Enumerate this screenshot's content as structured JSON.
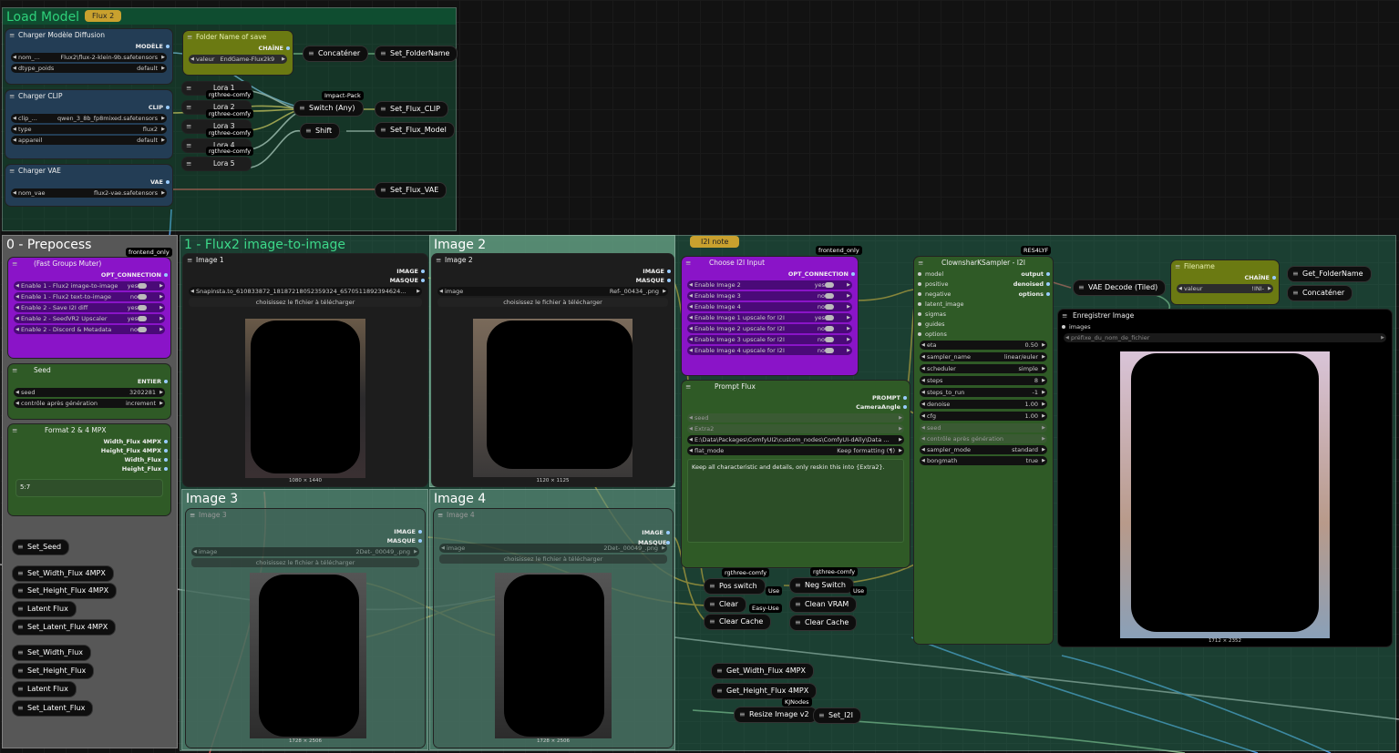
{
  "groups": {
    "load_model": "Load Model",
    "flux2_badge": "Flux 2",
    "prepocess": "0 - Prepocess",
    "flux2_i2i": "1 - Flux2 image-to-image",
    "image2": "Image 2",
    "image3": "Image 3",
    "image4": "Image 4",
    "i2i_note": "I2I note"
  },
  "tags": {
    "frontend_only": "frontend_only",
    "impact_pack": "Impact-Pack",
    "rgthree": "rgthree-comfy",
    "res4lyf": "RES4LYF",
    "kjnodes": "KJNodes",
    "use": "Use",
    "easy_use": "Easy-Use"
  },
  "diffusion": {
    "title": "Charger Modèle Diffusion",
    "out": "MODÈLE",
    "w1_label": "nom_...",
    "w1_val": "Flux2\\flux-2-klein-9b.safetensors",
    "w2_label": "dtype_poids",
    "w2_val": "default"
  },
  "clip": {
    "title": "Charger CLIP",
    "out": "CLIP",
    "w1_label": "clip_...",
    "w1_val": "qwen_3_8b_fp8mixed.safetensors",
    "w2_label": "type",
    "w2_val": "flux2",
    "w3_label": "appareil",
    "w3_val": "default"
  },
  "vae": {
    "title": "Charger VAE",
    "out": "VAE",
    "w1_label": "nom_vae",
    "w1_val": "flux2-vae.safetensors"
  },
  "folder": {
    "title": "Folder Name of save",
    "out": "CHAÎNE",
    "label": "valeur",
    "value": "EndGame-Flux2k9"
  },
  "loras": [
    "Lora 1",
    "Lora 2",
    "Lora 3",
    "Lora 4",
    "Lora 5"
  ],
  "pills": {
    "concat": "Concaténer",
    "set_folder": "Set_FolderName",
    "switch_any": "Switch (Any)",
    "set_clip": "Set_Flux_CLIP",
    "shift": "Shift",
    "set_model": "Set_Flux_Model",
    "set_vae": "Set_Flux_VAE"
  },
  "muter": {
    "title": "(Fast Groups Muter)",
    "out": "OPT_CONNECTION",
    "rows": [
      {
        "label": "Enable 1 - Flux2 image-to-image",
        "val": "yes"
      },
      {
        "label": "Enable 1 - Flux2 text-to-image",
        "val": "no"
      },
      {
        "label": "Enable 2 - Save I2I diff",
        "val": "yes"
      },
      {
        "label": "Enable 2 - SeedVR2 Upscaler",
        "val": "yes"
      },
      {
        "label": "Enable 2 - Discord & Metadata",
        "val": "no"
      }
    ]
  },
  "seed": {
    "title": "Seed",
    "out": "ENTIER",
    "w1_label": "seed",
    "w1_val": "3202281",
    "w2_label": "contrôle après génération",
    "w2_val": "increment"
  },
  "format": {
    "title": "Format  2 & 4 MPX",
    "outs": [
      "Width_Flux 4MPX",
      "Height_Flux 4MPX",
      "Width_Flux",
      "Height_Flux"
    ],
    "ratio": "5:7"
  },
  "set_pills": [
    "Set_Seed",
    "Set_Width_Flux 4MPX",
    "Set_Height_Flux 4MPX",
    "Latent Flux",
    "Set_Latent_Flux 4MPX",
    "Set_Width_Flux",
    "Set_Height_Flux",
    "Latent Flux",
    "Set_Latent_Flux"
  ],
  "image1": {
    "title": "Image 1",
    "out1": "IMAGE",
    "out2": "MASQUE",
    "file": "Snapinsta.to_610833872_18187218052359324_6570511892394624...",
    "upload": "choisissez le fichier à télécharger",
    "size": "1080 × 1440"
  },
  "image2n": {
    "title": "Image 2",
    "out1": "IMAGE",
    "out2": "MASQUE",
    "label": "image",
    "file": "Ref-_00434_.png",
    "upload": "choisissez le fichier à télécharger",
    "size": "1120 × 1125"
  },
  "image3n": {
    "title": "Image 3",
    "out1": "IMAGE",
    "out2": "MASQUE",
    "label": "image",
    "file": "2Det-_00049_.png",
    "upload": "choisissez le fichier à télécharger",
    "size": "1728 × 2506"
  },
  "image4n": {
    "title": "Image 4",
    "label": "image",
    "file": "2Det-_00049_.png",
    "upload": "choisissez le fichier à télécharger",
    "size": "1728 × 2506"
  },
  "choose": {
    "title": "Choose I2I Input",
    "out": "OPT_CONNECTION",
    "rows": [
      {
        "label": "Enable Image 2",
        "val": "yes"
      },
      {
        "label": "Enable Image 3",
        "val": "no"
      },
      {
        "label": "Enable Image 4",
        "val": "no"
      },
      {
        "label": "Enable Image 1 upscale for I2I",
        "val": "yes"
      },
      {
        "label": "Enable Image 2 upscale for I2I",
        "val": "no"
      },
      {
        "label": "Enable Image 3 upscale for I2I",
        "val": "no"
      },
      {
        "label": "Enable Image 4 upscale for I2I",
        "val": "no"
      }
    ]
  },
  "prompt": {
    "title": "Prompt Flux",
    "out1": "PROMPT",
    "out2": "CameraAngle",
    "seed": "seed",
    "extra": "Extra2",
    "path": "E:\\Data\\Packages\\ComfyUI2\\custom_nodes\\ComfyUI-dAlly\\Data ...",
    "flat_label": "flat_mode",
    "flat_val": "Keep formatting (¶)",
    "text": "Keep all characteristic and details, only reskin this into {Extra2}."
  },
  "sampler": {
    "title": "ClownsharKSampler - I2I",
    "inputs": [
      "model",
      "positive",
      "negative",
      "latent_image",
      "sigmas",
      "guides",
      "options"
    ],
    "outs": [
      "output",
      "denoised",
      "options"
    ],
    "widgets": [
      {
        "label": "eta",
        "val": "0.50"
      },
      {
        "label": "sampler_name",
        "val": "linear/euler"
      },
      {
        "label": "scheduler",
        "val": "simple"
      },
      {
        "label": "steps",
        "val": "8"
      },
      {
        "label": "steps_to_run",
        "val": "-1"
      },
      {
        "label": "denoise",
        "val": "1.00"
      },
      {
        "label": "cfg",
        "val": "1.00"
      }
    ],
    "seed": "seed",
    "control": "contrôle après génération",
    "mode_label": "sampler_mode",
    "mode_val": "standard",
    "bong_label": "bongmath",
    "bong_val": "true"
  },
  "vae_decode": "VAE Decode (Tiled)",
  "filename": {
    "title": "Filename",
    "out": "CHAÎNE",
    "label": "valeur",
    "value": "!INI-"
  },
  "get_folder": "Get_FolderName",
  "concat2": "Concaténer",
  "save": {
    "title": "Enregistrer Image",
    "in": "images",
    "prefix": "préfixe_du_nom_de_fichier",
    "size": "1712 × 2352"
  },
  "switches": {
    "pos": "Pos switch",
    "neg": "Neg Switch",
    "clear": "Clear",
    "clean_vram": "Clean VRAM",
    "clear_cache": "Clear Cache",
    "clear_cache2": "Clear Cache"
  },
  "gets": {
    "w": "Get_Width_Flux 4MPX",
    "h": "Get_Height_Flux 4MPX",
    "resize": "Resize Image v2",
    "set_i2i": "Set_I2I"
  }
}
